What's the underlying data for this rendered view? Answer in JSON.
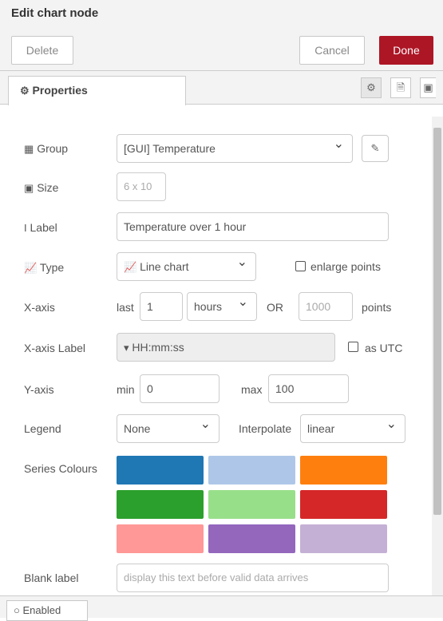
{
  "header": {
    "title": "Edit chart node"
  },
  "toolbar": {
    "delete_label": "Delete",
    "cancel_label": "Cancel",
    "done_label": "Done"
  },
  "tabs": {
    "properties_label": "Properties"
  },
  "form": {
    "group": {
      "label": "Group",
      "value": "[GUI] Temperature"
    },
    "size": {
      "label": "Size",
      "value": "6 x 10"
    },
    "chart_label": {
      "label": "Label",
      "value": "Temperature over 1 hour"
    },
    "type": {
      "label": "Type",
      "value": "Line chart",
      "enlarge_points_label": "enlarge points"
    },
    "x_axis": {
      "label": "X-axis",
      "last_label": "last",
      "last_value": "1",
      "unit": "hours",
      "or_label": "OR",
      "points_placeholder": "1000",
      "points_label": "points"
    },
    "x_axis_label": {
      "label": "X-axis Label",
      "value": "HH:mm:ss",
      "utc_label": "as UTC"
    },
    "y_axis": {
      "label": "Y-axis",
      "min_label": "min",
      "min_value": "0",
      "max_label": "max",
      "max_value": "100"
    },
    "legend": {
      "label": "Legend",
      "value": "None",
      "interpolate_label": "Interpolate",
      "interpolate_value": "linear"
    },
    "series_colours": {
      "label": "Series Colours",
      "colors": [
        "#1f77b4",
        "#aec7e8",
        "#ff7f0e",
        "#2ca02c",
        "#98df8a",
        "#d62728",
        "#ff9896",
        "#9467bd",
        "#c5b0d5"
      ]
    },
    "blank_label": {
      "label": "Blank label",
      "placeholder": "display this text before valid data arrives"
    }
  },
  "footer": {
    "enabled_label": "Enabled"
  }
}
